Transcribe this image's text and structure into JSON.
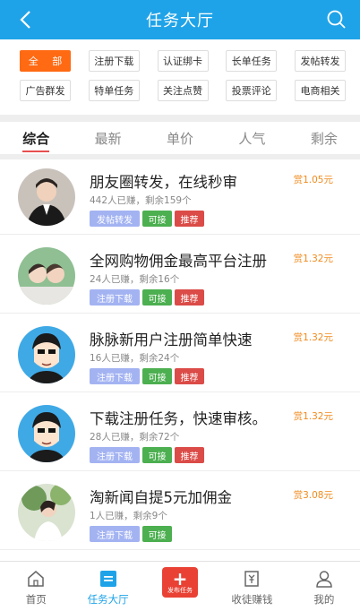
{
  "header": {
    "title": "任务大厅",
    "back_icon": "back-arrow-icon",
    "search_icon": "search-icon"
  },
  "categories": {
    "row1": [
      "全 部",
      "注册下载",
      "认证绑卡",
      "长单任务",
      "发帖转发"
    ],
    "row2": [
      "广告群发",
      "特单任务",
      "关注点赞",
      "投票评论",
      "电商相关"
    ],
    "active_index": 0
  },
  "sort_tabs": {
    "items": [
      "综合",
      "最新",
      "单价",
      "人气",
      "剩余"
    ],
    "active_index": 0
  },
  "tasks": [
    {
      "title": "朋友圈转发，在线秒审",
      "meta": "442人已赚，剩余159个",
      "reward": "赏1.05元",
      "tags": [
        "发帖转发",
        "可接",
        "推荐"
      ]
    },
    {
      "title": "全网购物佣金最高平台注册",
      "meta": "24人已赚，剩余16个",
      "reward": "赏1.32元",
      "tags": [
        "注册下载",
        "可接",
        "推荐"
      ]
    },
    {
      "title": "脉脉新用户注册简单快速",
      "meta": "16人已赚，剩余24个",
      "reward": "赏1.32元",
      "tags": [
        "注册下载",
        "可接",
        "推荐"
      ]
    },
    {
      "title": "下载注册任务，快速审核。",
      "meta": "28人已赚，剩余72个",
      "reward": "赏1.32元",
      "tags": [
        "注册下载",
        "可接",
        "推荐"
      ]
    },
    {
      "title": "淘新闻自提5元加佣金",
      "meta": "1人已赚，剩余9个",
      "reward": "赏3.08元",
      "tags": [
        "注册下载",
        "可接"
      ]
    }
  ],
  "tabbar": {
    "items": [
      {
        "label": "首页",
        "icon": "home-icon"
      },
      {
        "label": "任务大厅",
        "icon": "task-hall-icon"
      },
      {
        "label": "发布任务",
        "icon": "publish-plus-icon"
      },
      {
        "label": "收徒赚钱",
        "icon": "recruit-icon"
      },
      {
        "label": "我的",
        "icon": "profile-icon"
      }
    ],
    "active_index": 1
  },
  "colors": {
    "header_bg": "#1fa3e8",
    "active_category": "#ff6a13",
    "reward": "#f08a1c",
    "tag_blue": "#a3b3f2",
    "tag_green": "#4caf50",
    "tag_red": "#db4b47",
    "publish_button": "#e94235"
  }
}
